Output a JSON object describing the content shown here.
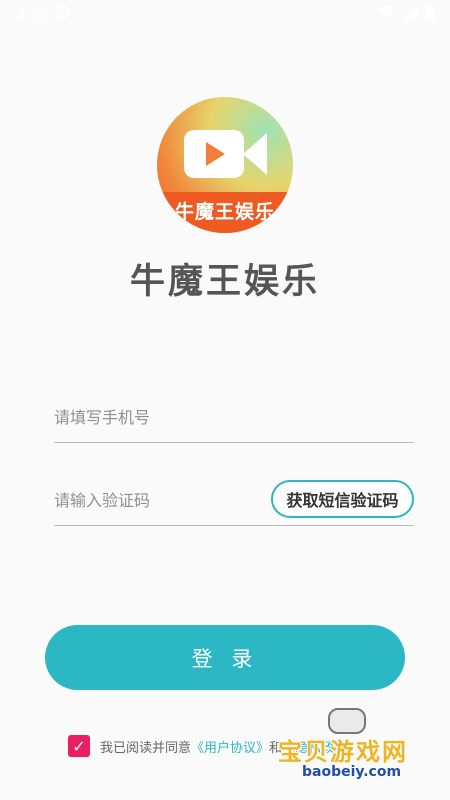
{
  "status_bar": {
    "time": "2:35",
    "icons": [
      "settings-icon",
      "wifi-icon",
      "signal-icon",
      "battery-icon"
    ]
  },
  "logo": {
    "text": "牛魔王娱乐",
    "icon": "video-camera-icon",
    "colors": {
      "band": "#ef5a23",
      "gradient_start": "#9fe3b5",
      "gradient_end": "#f05a2a"
    }
  },
  "app": {
    "title": "牛魔王娱乐"
  },
  "form": {
    "phone_placeholder": "请填写手机号",
    "code_placeholder": "请输入验证码",
    "get_code_label": "获取短信验证码",
    "login_label": "登 录"
  },
  "agreement": {
    "prefix": "我已阅读并同意",
    "user_agreement": "《用户协议》",
    "conjunction": "和",
    "privacy_policy": "《隐私政策》",
    "checked": true
  },
  "watermark": {
    "text": "宝贝游戏网",
    "url": "baobeiy.com"
  },
  "colors": {
    "accent": "#2cb7c5",
    "checkbox": "#e91e63",
    "background": "#fafafa"
  }
}
